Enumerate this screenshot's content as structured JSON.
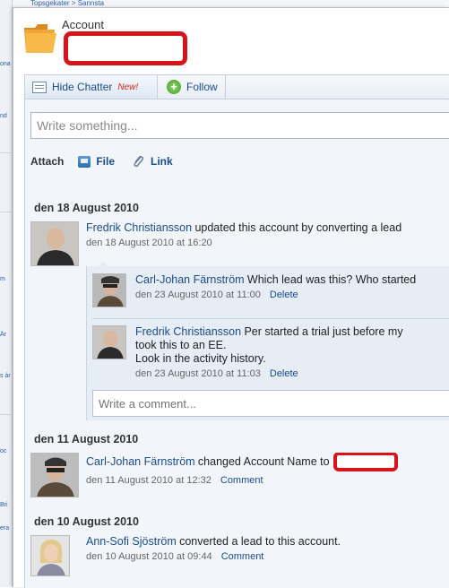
{
  "background": {
    "breadcrumb": "Topsgekater > Sannsta",
    "left_fragments": [
      "ona",
      "nd",
      "m",
      "Är",
      "s ár",
      "oc",
      "Bri",
      "era"
    ]
  },
  "account": {
    "label": "Account",
    "icon": "folder-icon"
  },
  "toolbar": {
    "hide_chatter_label": "Hide Chatter",
    "new_badge": "New!",
    "follow_label": "Follow"
  },
  "composer": {
    "placeholder": "Write something...",
    "attach_label": "Attach",
    "file_label": "File",
    "link_label": "Link"
  },
  "feed": {
    "groups": [
      {
        "date": "den 18 August 2010",
        "post": {
          "author": "Fredrik Christiansson",
          "text": "updated this account by converting a lead",
          "meta": "den 18 August 2010 at 16:20"
        },
        "comments": [
          {
            "author": "Carl-Johan Färnström",
            "text": "Which lead was this? Who started",
            "meta": "den 23 August 2010 at 11:00",
            "action": "Delete"
          },
          {
            "author": "Fredrik Christiansson",
            "text_line1": "Per started a trial just before my",
            "text_line2": "took this to an EE.",
            "text_line3": "Look in the activity history.",
            "meta": "den 23 August 2010 at 11:03",
            "action": "Delete"
          }
        ],
        "comment_placeholder": "Write a comment..."
      },
      {
        "date": "den 11 August 2010",
        "post": {
          "author": "Carl-Johan Färnström",
          "text": "changed Account Name to",
          "meta": "den 11 August 2010 at 12:32",
          "action": "Comment"
        }
      },
      {
        "date": "den 10 August 2010",
        "post": {
          "author": "Ann-Sofi Sjöström",
          "text": "converted a lead to this account.",
          "meta": "den 10 August 2010 at 09:44",
          "action": "Comment"
        }
      }
    ]
  },
  "colors": {
    "link": "#1a4b8c",
    "redaction": "#d8141b",
    "new_badge": "#e0241a",
    "feed_bg": "#f2f6fa"
  }
}
